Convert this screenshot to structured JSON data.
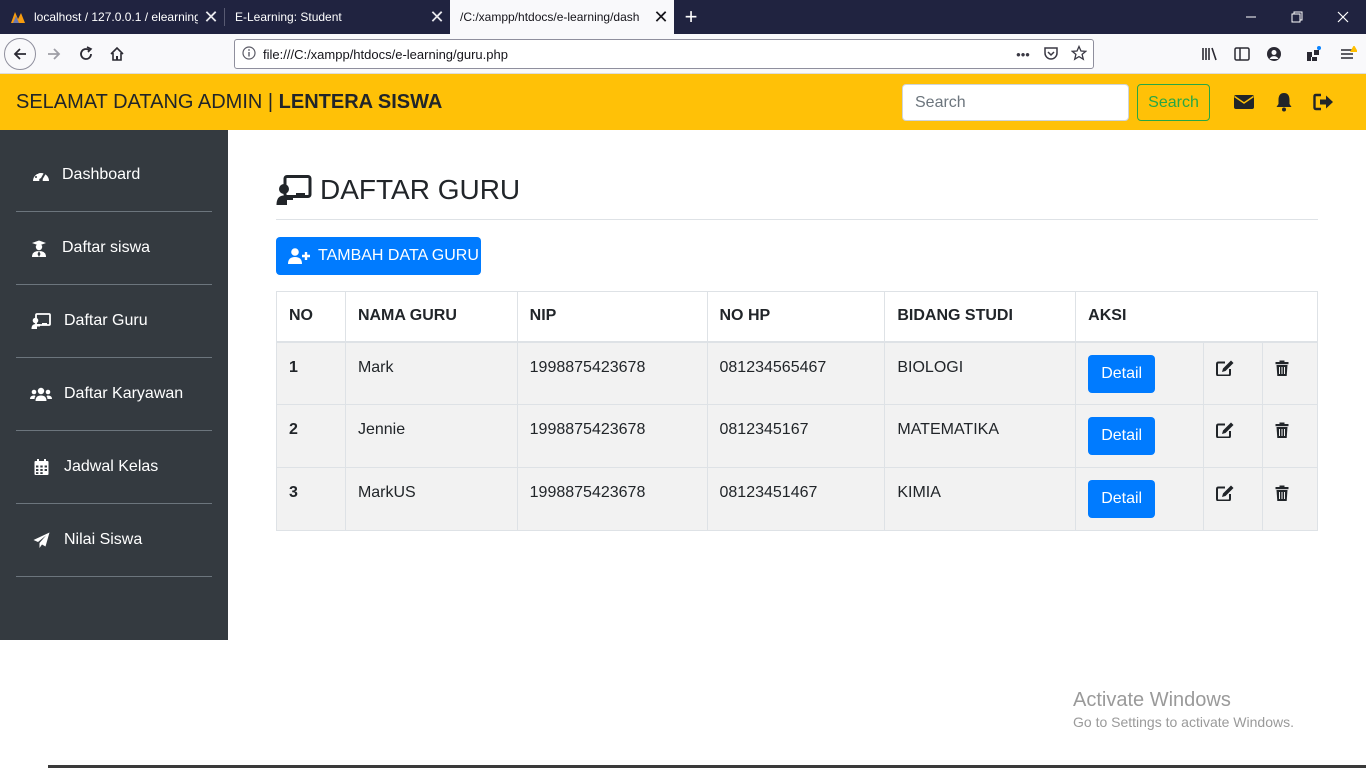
{
  "browser": {
    "tabs": [
      {
        "title": "localhost / 127.0.0.1 / elearning",
        "active": false
      },
      {
        "title": "E-Learning: Student",
        "active": false
      },
      {
        "title": "/C:/xampp/htdocs/e-learning/dash",
        "active": true
      }
    ],
    "close_glyph": "✕",
    "newtab_glyph": "+",
    "url": "file:///C:/xampp/htdocs/e-learning/guru.php",
    "url_actions_glyph": "•••"
  },
  "header": {
    "welcome": "SELAMAT DATANG ADMIN | ",
    "brand": "LENTERA SISWA",
    "search_placeholder": "Search",
    "search_button": "Search",
    "icons": [
      "envelope-icon",
      "bell-icon",
      "sign-out-icon"
    ]
  },
  "sidebar": {
    "items": [
      {
        "label": "Dashboard",
        "icon": "tachometer-icon"
      },
      {
        "label": "Daftar siswa",
        "icon": "user-graduate-icon"
      },
      {
        "label": "Daftar Guru",
        "icon": "chalkboard-teacher-icon"
      },
      {
        "label": "Daftar Karyawan",
        "icon": "users-icon"
      },
      {
        "label": "Jadwal Kelas",
        "icon": "calendar-icon"
      },
      {
        "label": "Nilai Siswa",
        "icon": "paper-plane-icon"
      }
    ]
  },
  "main": {
    "title": "DAFTAR GURU",
    "add_button": "TAMBAH DATA GURU",
    "table": {
      "headers": [
        "NO",
        "NAMA GURU",
        "NIP",
        "NO HP",
        "BIDANG STUDI",
        "AKSI"
      ],
      "rows": [
        {
          "no": "1",
          "nama": "Mark",
          "nip": "1998875423678",
          "hp": "081234565467",
          "bidang": "BIOLOGI",
          "detail": "Detail"
        },
        {
          "no": "2",
          "nama": "Jennie",
          "nip": "1998875423678",
          "hp": "0812345167",
          "bidang": "MATEMATIKA",
          "detail": "Detail"
        },
        {
          "no": "3",
          "nama": "MarkUS",
          "nip": "1998875423678",
          "hp": "08123451467",
          "bidang": "KIMIA",
          "detail": "Detail"
        }
      ]
    }
  },
  "watermark": {
    "line1": "Activate Windows",
    "line2": "Go to Settings to activate Windows."
  },
  "colors": {
    "header_bg": "#ffc107",
    "sidebar_bg": "#343a40",
    "primary": "#007bff",
    "success": "#28a745",
    "tabbar_bg": "#202340"
  }
}
